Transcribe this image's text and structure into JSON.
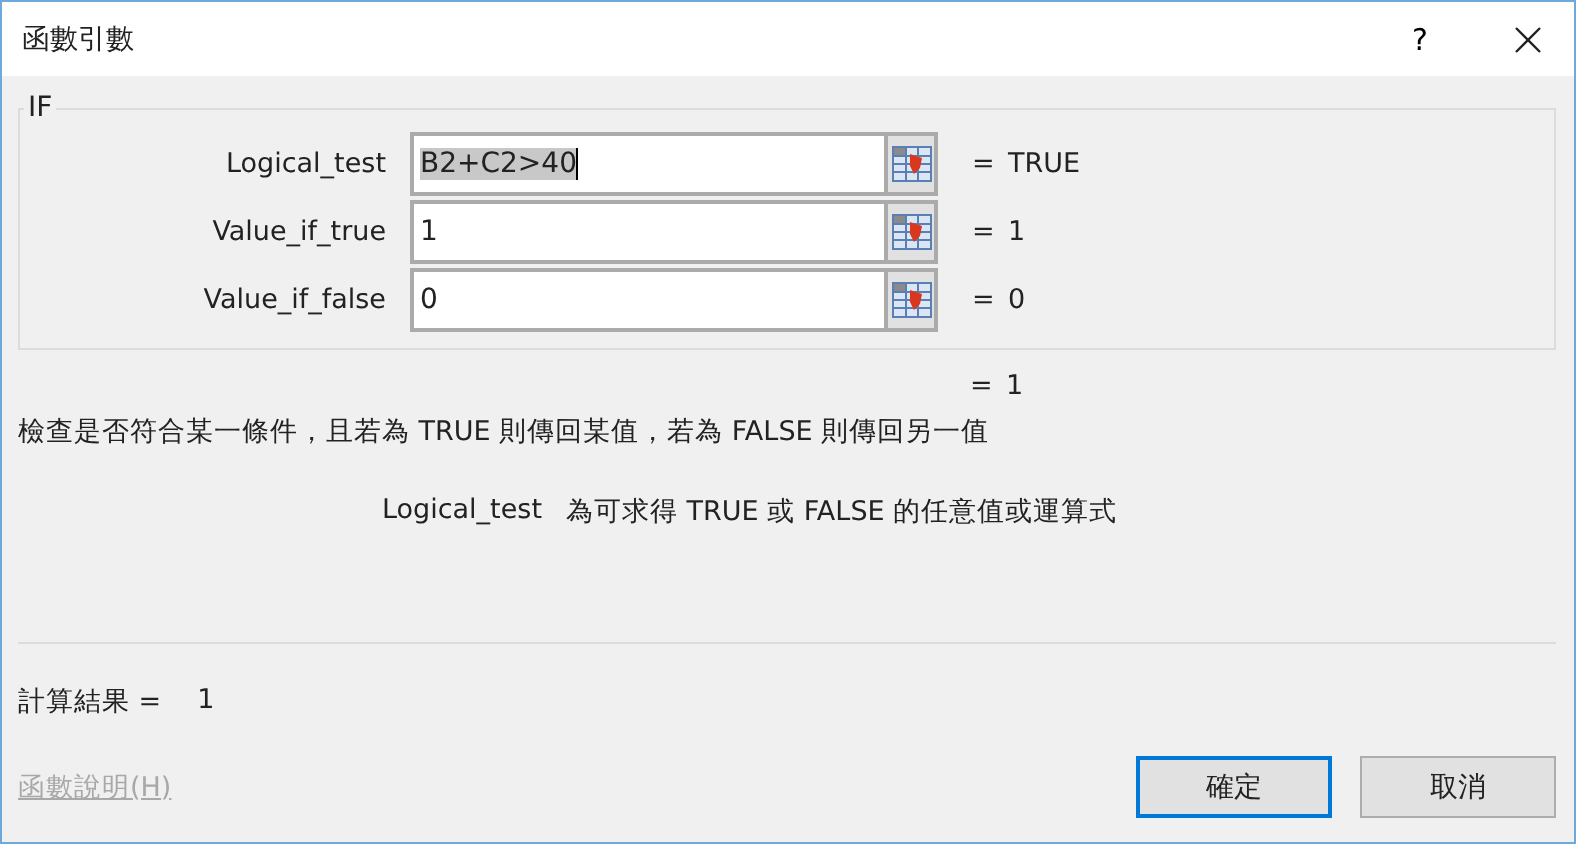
{
  "window": {
    "title": "函數引數",
    "help_button": "?"
  },
  "function": {
    "name": "IF",
    "arguments": [
      {
        "label": "Logical_test",
        "value": "B2+C2>40",
        "selected": true,
        "sign": "=",
        "result": "TRUE"
      },
      {
        "label": "Value_if_true",
        "value": "1",
        "selected": false,
        "sign": "=",
        "result": "1"
      },
      {
        "label": "Value_if_false",
        "value": "0",
        "selected": false,
        "sign": "=",
        "result": "0"
      }
    ]
  },
  "formula_result": {
    "sign": "=",
    "value": "1"
  },
  "description": "檢查是否符合某一條件，且若為 TRUE 則傳回某值，若為 FALSE 則傳回另一值",
  "argument_help": {
    "name": "Logical_test",
    "text": "為可求得 TRUE 或 FALSE 的任意值或運算式"
  },
  "result": {
    "label": "計算結果 =",
    "value": "1"
  },
  "help_link": {
    "label": "函數說明(H)",
    "disabled": true
  },
  "buttons": [
    {
      "label": "確定",
      "default": true
    },
    {
      "label": "取消",
      "default": false
    }
  ]
}
